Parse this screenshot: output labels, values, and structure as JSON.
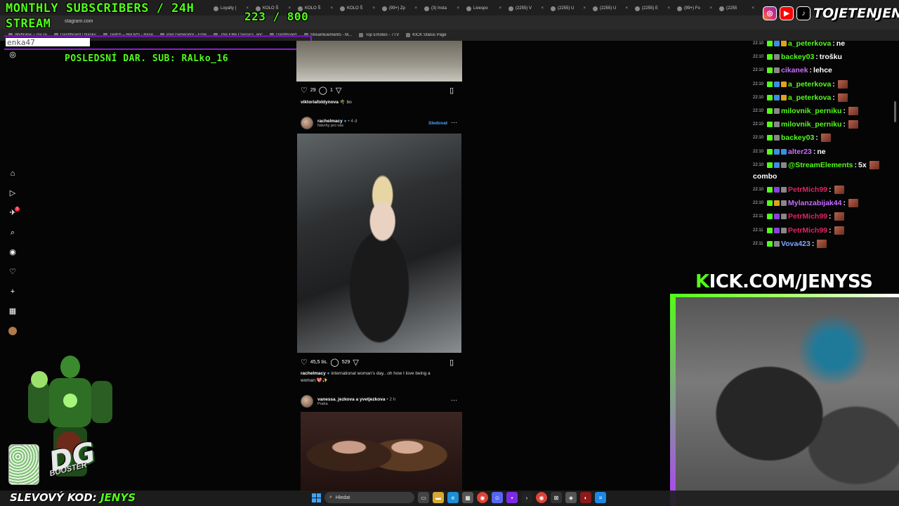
{
  "browser": {
    "tabs": [
      "Loyalty |",
      "KOLO Š",
      "KOLO Š",
      "KOLO Š",
      "(99+) Zp",
      "(3) Insta",
      "Livespo",
      "(2255) V",
      "(2255) U",
      "(2255) U",
      "(2255) E",
      "(99+) Fo",
      "(2255"
    ],
    "url": "stagram.com",
    "bookmarks": [
      "Wybrane ~ rsy ra",
      "Dashboard | Nasky",
      "Twitch – BeUPS - Base",
      "Pair Generator - FrVe",
      "The Elite Classics, anc",
      "Dashboard",
      "StreamElements - M...",
      "Top Emotes - 7TV",
      "KICK Status Page"
    ]
  },
  "overlay": {
    "title_line1": "MONTHLY SUBSCRIBERS / 24H",
    "title_line2": "STREAM",
    "subs_counter": "223  / 800",
    "last_donation": "POSLEDSNÍ DAR. SUB: RALko_16",
    "donor_ticker": "enka47",
    "social_handle": "TOJETENJENYS",
    "kick_url_prefix": "K",
    "kick_url": "ICK.COM/JENYSS",
    "promo_label": "SLEVOVÝ KOD:",
    "promo_code": "JENYS",
    "product_logo": "DG",
    "product_name": "BOOSTER",
    "colors": {
      "kick_green": "#53fc18",
      "purple_frame": "#8c1bd6"
    }
  },
  "instagram": {
    "rail_icons": [
      "instagram-icon",
      "home-icon",
      "reels-icon",
      "messages-icon",
      "search-icon",
      "explore-icon",
      "notifications-icon",
      "create-icon",
      "dashboard-icon",
      "profile-icon"
    ],
    "notification_badge": "1",
    "post1": {
      "likes": "29",
      "comments": "1",
      "caption_user": "viktoriafoldynova",
      "caption_text": "🌴 bo"
    },
    "post2": {
      "user": "rachelmacy",
      "time": "• 4 d",
      "sub": "Návrhy pro vás",
      "follow": "Sledovat",
      "likes": "45,5 tis.",
      "comments": "529",
      "caption_user": "rachelmacy",
      "caption_text": "international woman's day.. oh how I love being a",
      "caption_text2": "woman 💖✨"
    },
    "post3": {
      "user": "vanessa_jezkova a yvetjezkova",
      "time": "• 2 h",
      "sub": "Praha"
    }
  },
  "chat": {
    "messages": [
      {
        "time": "22:10",
        "user": "a_peterkova",
        "color": "#53fc18",
        "text": "ne",
        "emote": false
      },
      {
        "time": "22:10",
        "user": "backey03",
        "color": "#53fc18",
        "text": "trošku",
        "emote": false
      },
      {
        "time": "22:10",
        "user": "cikanek",
        "color": "#c86dff",
        "text": "lehce",
        "emote": false
      },
      {
        "time": "22:10",
        "user": "a_peterkova",
        "color": "#53fc18",
        "text": "",
        "emote": true
      },
      {
        "time": "22:10",
        "user": "a_peterkova",
        "color": "#53fc18",
        "text": "",
        "emote": true
      },
      {
        "time": "22:10",
        "user": "milovnik_perniku",
        "color": "#53fc18",
        "text": "",
        "emote": true
      },
      {
        "time": "22:10",
        "user": "milovnik_perniku",
        "color": "#53fc18",
        "text": "",
        "emote": true
      },
      {
        "time": "22:10",
        "user": "backey03",
        "color": "#53fc18",
        "text": "",
        "emote": true
      },
      {
        "time": "22:10",
        "user": "alter23",
        "color": "#c86dff",
        "text": "ne",
        "emote": false
      },
      {
        "time": "22:10",
        "user": "@StreamElements",
        "color": "#53fc18",
        "text": "5x",
        "emote": true,
        "wrap": "combo"
      },
      {
        "time": "22:10",
        "user": "PetrMich99",
        "color": "#e0245e",
        "text": "",
        "emote": true
      },
      {
        "time": "22:10",
        "user": "Mylanzabijak44",
        "color": "#c86dff",
        "text": "",
        "emote": true
      },
      {
        "time": "22:11",
        "user": "PetrMich99",
        "color": "#e0245e",
        "text": "",
        "emote": true
      },
      {
        "time": "22:11",
        "user": "PetrMich99",
        "color": "#e0245e",
        "text": "",
        "emote": true
      },
      {
        "time": "22:11",
        "user": "Vova423",
        "color": "#7fa7ff",
        "text": "",
        "emote": true
      }
    ]
  },
  "taskbar": {
    "search_placeholder": "Hledat",
    "apps": [
      "file-icon",
      "folder-icon",
      "edge-icon",
      "store-icon",
      "chrome-icon",
      "discord-icon",
      "app-icon",
      "terminal-icon",
      "chrome-icon",
      "xbox-icon",
      "app2-icon",
      "app3-icon",
      "notes-icon"
    ]
  }
}
